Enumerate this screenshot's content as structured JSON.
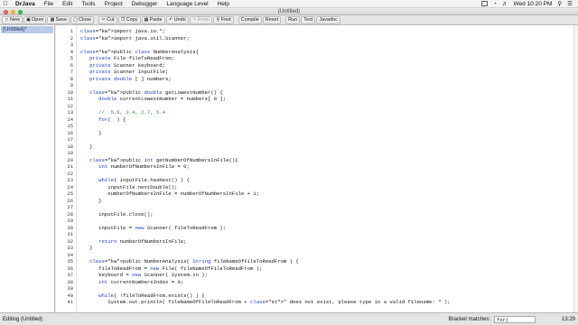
{
  "menubar": {
    "app_name": "DrJava",
    "items": [
      "File",
      "Edit",
      "Tools",
      "Project",
      "Debugger",
      "Language Level",
      "Help"
    ],
    "clock": "Wed 10:20 PM"
  },
  "window": {
    "title": "(Untitled)"
  },
  "toolbar": {
    "buttons": [
      {
        "label": "New",
        "icon": "new-file-icon"
      },
      {
        "label": "Open",
        "icon": "open-folder-icon"
      },
      {
        "label": "Save",
        "icon": "save-icon"
      },
      {
        "label": "Close",
        "icon": "close-icon"
      },
      {
        "label": "Cut",
        "icon": "cut-icon"
      },
      {
        "label": "Copy",
        "icon": "copy-icon"
      },
      {
        "label": "Paste",
        "icon": "paste-icon"
      },
      {
        "label": "Undo",
        "icon": "undo-icon"
      },
      {
        "label": "Redo",
        "icon": "redo-icon"
      },
      {
        "label": "Find",
        "icon": "find-icon"
      },
      {
        "label": "Compile",
        "icon": ""
      },
      {
        "label": "Reset",
        "icon": ""
      },
      {
        "label": "Run",
        "icon": ""
      },
      {
        "label": "Test",
        "icon": ""
      },
      {
        "label": "Javadoc",
        "icon": ""
      }
    ]
  },
  "file_panel": {
    "open_document": "(Untitled)*"
  },
  "editor": {
    "lines": [
      {
        "n": "1",
        "text": "import java.io.*;"
      },
      {
        "n": "2",
        "text": "import java.util.Scanner;"
      },
      {
        "n": "3",
        "text": ""
      },
      {
        "n": "4",
        "text": "public class NumberAnalysis{"
      },
      {
        "n": "5",
        "text": "   private File fileToReadFrom;"
      },
      {
        "n": "6",
        "text": "   private Scanner keyboard;"
      },
      {
        "n": "7",
        "text": "   private Scanner inputFile;"
      },
      {
        "n": "8",
        "text": "   private double [ ] numbers;"
      },
      {
        "n": "9",
        "text": ""
      },
      {
        "n": "10",
        "text": "   public double getLowestNumber() {"
      },
      {
        "n": "11",
        "text": "      double currentLowestNumber = numbers[ 0 ];"
      },
      {
        "n": "12",
        "text": ""
      },
      {
        "n": "13",
        "text": "      //  5.6, 3.4, 2.7, 5.4"
      },
      {
        "n": "14",
        "text": "      for(  ) {"
      },
      {
        "n": "15",
        "text": ""
      },
      {
        "n": "16",
        "text": "      }"
      },
      {
        "n": "17",
        "text": ""
      },
      {
        "n": "18",
        "text": "   }"
      },
      {
        "n": "19",
        "text": ""
      },
      {
        "n": "20",
        "text": "   public int getNumberOfNumbersInFile(){"
      },
      {
        "n": "21",
        "text": "      int numberOfNumbersInFile = 0;"
      },
      {
        "n": "22",
        "text": ""
      },
      {
        "n": "23",
        "text": "      while( inputFile.hasNext() ) {"
      },
      {
        "n": "24",
        "text": "         inputFile.nextDouble();"
      },
      {
        "n": "25",
        "text": "         numberOfNumbersInFile = numberOfNumbersInFile + 1;"
      },
      {
        "n": "26",
        "text": "      }"
      },
      {
        "n": "27",
        "text": ""
      },
      {
        "n": "28",
        "text": "      inputFile.close();"
      },
      {
        "n": "29",
        "text": ""
      },
      {
        "n": "30",
        "text": "      inputFile = new Scanner( fileToReadFrom );"
      },
      {
        "n": "31",
        "text": ""
      },
      {
        "n": "32",
        "text": "      return numberOfNumbersInFile;"
      },
      {
        "n": "33",
        "text": "   }"
      },
      {
        "n": "34",
        "text": ""
      },
      {
        "n": "35",
        "text": "   public NumberAnalysis( String fileNameOfFileToReadFrom ) {"
      },
      {
        "n": "36",
        "text": "      fileToReadFrom = new File( fileNameOfFileToReadFrom );"
      },
      {
        "n": "37",
        "text": "      keyboard = new Scanner( System.in );"
      },
      {
        "n": "38",
        "text": "      int currentNumbersIndex = 0;"
      },
      {
        "n": "39",
        "text": ""
      },
      {
        "n": "40",
        "text": "      while( !fileToReadFrom.exists() ) {"
      },
      {
        "n": "41",
        "text": "         System.out.println( fileNameOfFileToReadFrom + \" does not exist, please type in a valid filename: \" );"
      }
    ]
  },
  "statusbar": {
    "editing": "Editing (Untitled)",
    "bracket_label": "Bracket matches:",
    "bracket_value": "for(",
    "position": "13:29"
  },
  "colors": {
    "keyword": "#1d3dc7",
    "comment": "#2c8a2c",
    "string": "#a33"
  }
}
